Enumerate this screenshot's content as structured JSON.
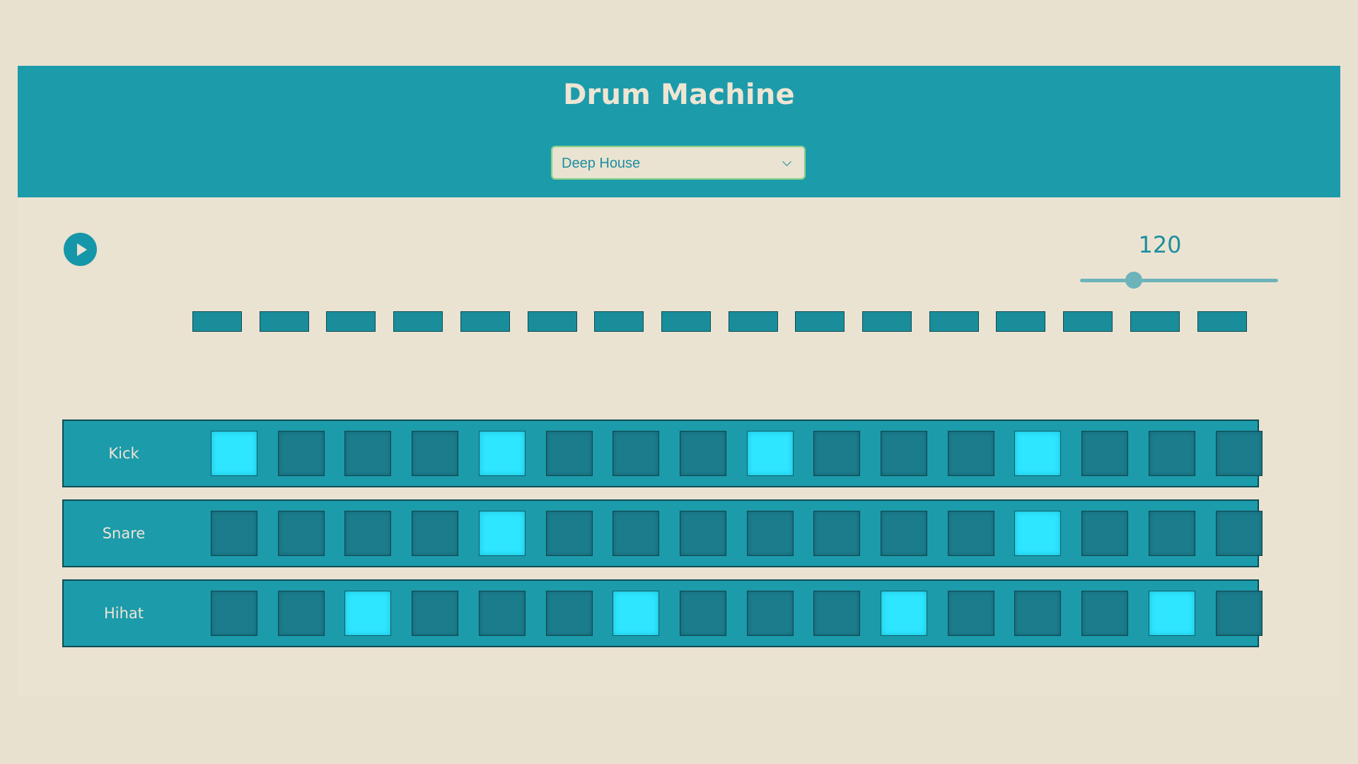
{
  "app": {
    "title": "Drum Machine"
  },
  "preset": {
    "selected": "Deep House"
  },
  "transport": {
    "play_icon": "play-icon",
    "tempo": "120",
    "tempo_slider_fraction": 0.27
  },
  "steps": 16,
  "tracks": [
    {
      "label": "Kick",
      "pattern": [
        1,
        0,
        0,
        0,
        1,
        0,
        0,
        0,
        1,
        0,
        0,
        0,
        1,
        0,
        0,
        0
      ]
    },
    {
      "label": "Snare",
      "pattern": [
        0,
        0,
        0,
        0,
        1,
        0,
        0,
        0,
        0,
        0,
        0,
        0,
        1,
        0,
        0,
        0
      ]
    },
    {
      "label": "Hihat",
      "pattern": [
        0,
        0,
        1,
        0,
        0,
        0,
        1,
        0,
        0,
        0,
        1,
        0,
        0,
        0,
        1,
        0
      ]
    }
  ],
  "colors": {
    "background": "#e9e1cf",
    "accent": "#1c9bab",
    "pad_off": "#1b7c8c",
    "pad_on": "#2ee6ff"
  }
}
